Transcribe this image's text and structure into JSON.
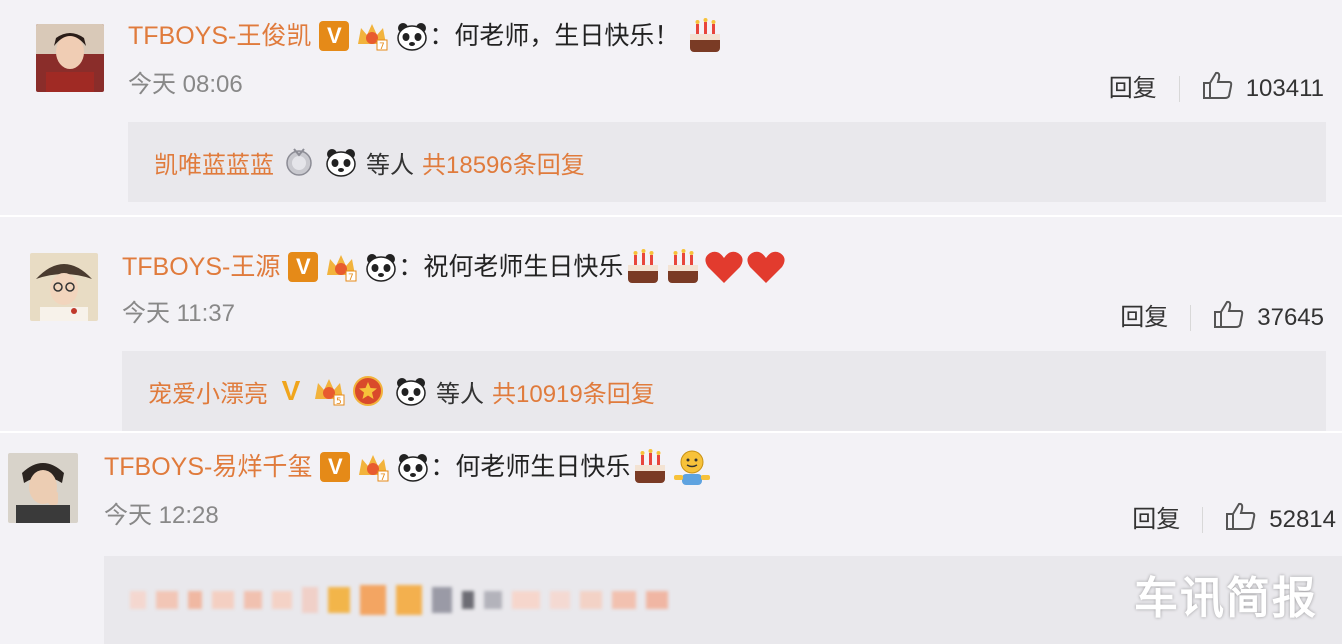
{
  "comments": [
    {
      "username": "TFBOYS-王俊凯",
      "text": "：何老师，生日快乐！",
      "time": "今天 08:06",
      "reply_label": "回复",
      "likes": "103411",
      "reply_box": {
        "user": "凯唯蓝蓝蓝",
        "tail": "等人",
        "count": "共18596条回复"
      }
    },
    {
      "username": "TFBOYS-王源",
      "text": "：祝何老师生日快乐",
      "time": "今天 11:37",
      "reply_label": "回复",
      "likes": "37645",
      "reply_box": {
        "user": "宠爱小漂亮",
        "tail": "等人",
        "count": "共10919条回复"
      }
    },
    {
      "username": "TFBOYS-易烊千玺",
      "text": "：何老师生日快乐",
      "time": "今天 12:28",
      "reply_label": "回复",
      "likes": "52814"
    }
  ],
  "watermark": "车讯简报",
  "colors": {
    "username": "#e07b3c",
    "badge": "#e58a18",
    "background": "#f3f2f6",
    "reply_bg": "#e9e8ec"
  }
}
